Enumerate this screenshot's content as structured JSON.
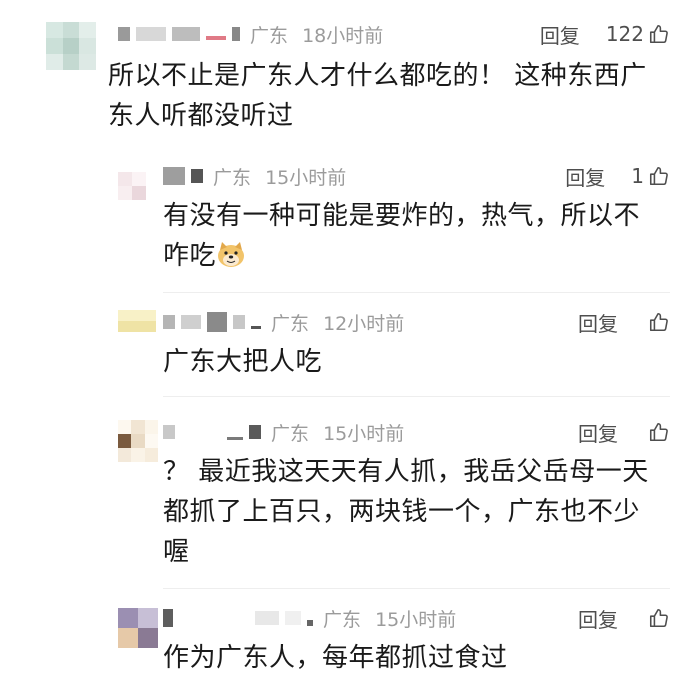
{
  "comments": [
    {
      "region": "广东",
      "time": "18小时前",
      "reply_label": "回复",
      "likes": "122",
      "text_lines": [
        "所以不止是广东人才什么都吃的！  这种东西广",
        "东人听都没听过"
      ]
    },
    {
      "region": "广东",
      "time": "15小时前",
      "reply_label": "回复",
      "likes": "1",
      "text_lines": [
        "有没有一种可能是要炸的，热气，所以不",
        "咋吃"
      ],
      "emoji": "doge-emoji"
    },
    {
      "region": "广东",
      "time": "12小时前",
      "reply_label": "回复",
      "likes": "",
      "text_lines": [
        "广东大把人吃"
      ]
    },
    {
      "region": "广东",
      "time": "15小时前",
      "reply_label": "回复",
      "likes": "",
      "text_lines": [
        "？ 最近我这天天有人抓，我岳父岳母一天",
        "都抓了上百只，两块钱一个，广东也不少",
        "喔"
      ]
    },
    {
      "region": "广东",
      "time": "15小时前",
      "reply_label": "回复",
      "likes": "",
      "text_lines": [
        "作为广东人，每年都抓过食过"
      ]
    }
  ],
  "icons": {
    "like": "thumbs-up-icon"
  },
  "colors": {
    "text": "#1a1a1a",
    "meta": "#9b9b9b",
    "action": "#4e4e4e"
  }
}
